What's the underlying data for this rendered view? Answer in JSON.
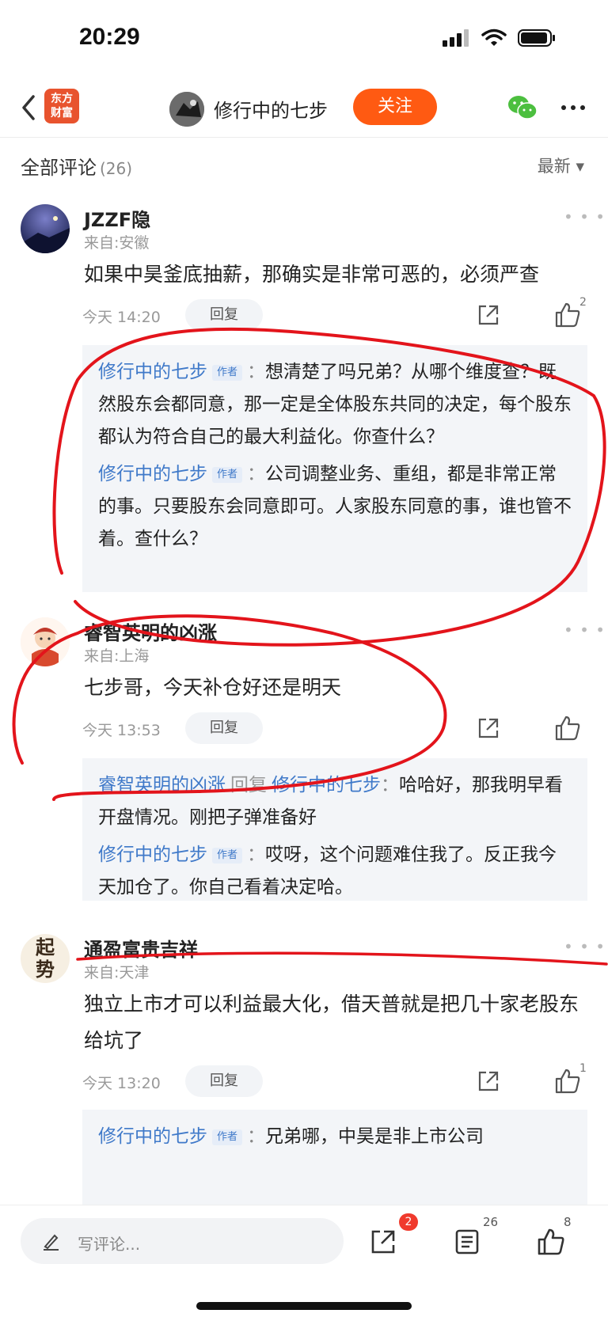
{
  "status_bar": {
    "time": "20:29"
  },
  "nav": {
    "logo_line1": "东方",
    "logo_line2": "财富",
    "title": "修行中的七步",
    "follow_label": "关注"
  },
  "comments_header": {
    "title": "全部评论",
    "count": "(26)",
    "sort": "最新 ▾"
  },
  "comments": [
    {
      "user": "JZZF隐",
      "location": "来自:安徽",
      "text": "如果中昊釜底抽薪，那确实是非常可恶的，必须严查",
      "time": "今天 14:20",
      "reply_label": "回复",
      "likes": "2",
      "replies": [
        {
          "author": "修行中的七步",
          "tag": "作者",
          "text": "想清楚了吗兄弟？从哪个维度查？既然股东会都同意，那一定是全体股东共同的决定，每个股东都认为符合自己的最大利益化。你查什么？"
        },
        {
          "author": "修行中的七步",
          "tag": "作者",
          "text": "公司调整业务、重组，都是非常正常的事。只要股东会同意即可。人家股东同意的事，谁也管不着。查什么？"
        }
      ]
    },
    {
      "user": "睿智英明的凶涨",
      "location": "来自:上海",
      "text": "七步哥，今天补仓好还是明天",
      "time": "今天 13:53",
      "reply_label": "回复",
      "likes": "",
      "replies": [
        {
          "author": "睿智英明的凶涨",
          "mid": "回复",
          "target": "修行中的七步",
          "text": "哈哈好，那我明早看开盘情况。刚把子弹准备好"
        },
        {
          "author": "修行中的七步",
          "tag": "作者",
          "text": "哎呀，这个问题难住我了。反正我今天加仓了。你自己看着决定哈。"
        }
      ]
    },
    {
      "user": "通盈富贵吉祥",
      "location": "来自:天津",
      "text": "独立上市才可以利益最大化，借天普就是把几十家老股东给坑了",
      "time": "今天 13:20",
      "reply_label": "回复",
      "likes": "1",
      "replies": [
        {
          "author": "修行中的七步",
          "tag": "作者",
          "text": "兄弟哪，中昊是非上市公司"
        }
      ]
    }
  ],
  "avatar_text": {
    "c3_line1": "起",
    "c3_line2": "势"
  },
  "bottom_bar": {
    "write_placeholder": "写评论...",
    "share_badge": "2",
    "comment_count": "26",
    "like_count": "8"
  },
  "colors": {
    "accent": "#ff5a12",
    "link": "#3f79c9",
    "annotation": "#e3141b",
    "badge": "#f03a2d"
  }
}
